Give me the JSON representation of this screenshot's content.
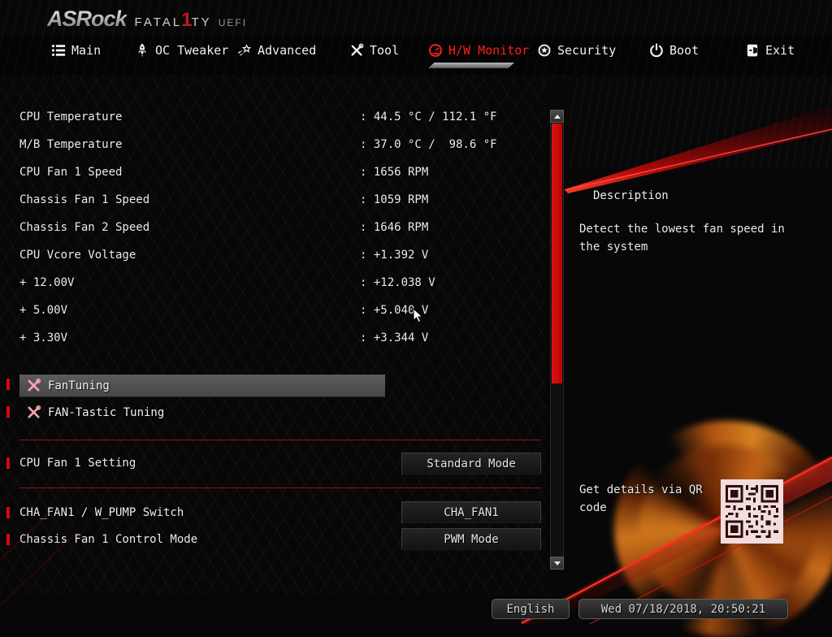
{
  "logo": {
    "brand": "ASRock",
    "fatal_pre": "FATAL",
    "fatal_one": "1",
    "fatal_post": "TY",
    "uefi": "UEFI"
  },
  "nav": {
    "tabs": [
      {
        "label": "Main",
        "icon": "list-icon",
        "active": false
      },
      {
        "label": "OC Tweaker",
        "icon": "rocket-icon",
        "active": false
      },
      {
        "label": "Advanced",
        "icon": "shooting-star-icon",
        "active": false
      },
      {
        "label": "Tool",
        "icon": "tools-icon",
        "active": false
      },
      {
        "label": "H/W Monitor",
        "icon": "gauge-icon",
        "active": true
      },
      {
        "label": "Security",
        "icon": "badge-icon",
        "active": false
      },
      {
        "label": "Boot",
        "icon": "power-icon",
        "active": false
      },
      {
        "label": "Exit",
        "icon": "door-icon",
        "active": false
      }
    ]
  },
  "sensors": [
    {
      "label": "CPU Temperature",
      "value": ": 44.5 °C / 112.1 °F"
    },
    {
      "label": "M/B Temperature",
      "value": ": 37.0 °C /  98.6 °F"
    },
    {
      "label": "CPU Fan 1 Speed",
      "value": ": 1656 RPM"
    },
    {
      "label": "Chassis Fan 1 Speed",
      "value": ": 1059 RPM"
    },
    {
      "label": "Chassis Fan 2 Speed",
      "value": ": 1646 RPM"
    },
    {
      "label": "CPU Vcore Voltage",
      "value": ": +1.392 V"
    },
    {
      "label": "+ 12.00V",
      "value": ": +12.038 V"
    },
    {
      "label": "+ 5.00V",
      "value": ": +5.040 V"
    },
    {
      "label": "+ 3.30V",
      "value": ": +3.344 V"
    }
  ],
  "fan_items": [
    {
      "label": "FanTuning",
      "selected": true
    },
    {
      "label": "FAN-Tastic Tuning",
      "selected": false
    }
  ],
  "settings": [
    {
      "label": "CPU Fan 1 Setting",
      "value": "Standard Mode"
    },
    {
      "label": "CHA_FAN1 / W_PUMP Switch",
      "value": "CHA_FAN1"
    },
    {
      "label": "Chassis Fan 1 Control Mode",
      "value": "PWM Mode"
    }
  ],
  "description": {
    "title": "Description",
    "body": "Detect the lowest fan speed in the system",
    "qr_caption": "Get details via QR code"
  },
  "footer": {
    "language": "English",
    "datetime": "Wed 07/18/2018, 20:50:21"
  },
  "colors": {
    "accent_red": "#cc0000",
    "active_tab": "#ff1f1f",
    "highlight_gray": "#4f4f4f",
    "icon_pink": "#f4a7ad"
  }
}
